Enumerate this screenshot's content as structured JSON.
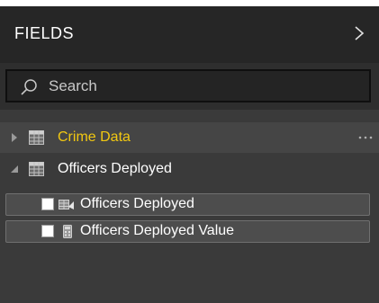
{
  "header": {
    "title": "FIELDS",
    "collapse_icon": "chevron-right-icon"
  },
  "search": {
    "placeholder": "Search",
    "value": "",
    "icon": "search-icon"
  },
  "tables": [
    {
      "name": "Crime Data",
      "expanded": false,
      "selected": true,
      "label_color": "#f2c811",
      "icon": "table-icon",
      "more_icon": "more-options-icon"
    },
    {
      "name": "Officers Deployed",
      "expanded": true,
      "icon": "table-icon",
      "fields": [
        {
          "label": "Officers Deployed",
          "checked": false,
          "icon": "column-field-icon"
        },
        {
          "label": "Officers Deployed Value",
          "checked": false,
          "icon": "calculator-measure-icon"
        }
      ]
    }
  ],
  "colors": {
    "panel_bg": "#3a3a3a",
    "header_bg": "#262626",
    "accent_yellow": "#f2c811"
  }
}
